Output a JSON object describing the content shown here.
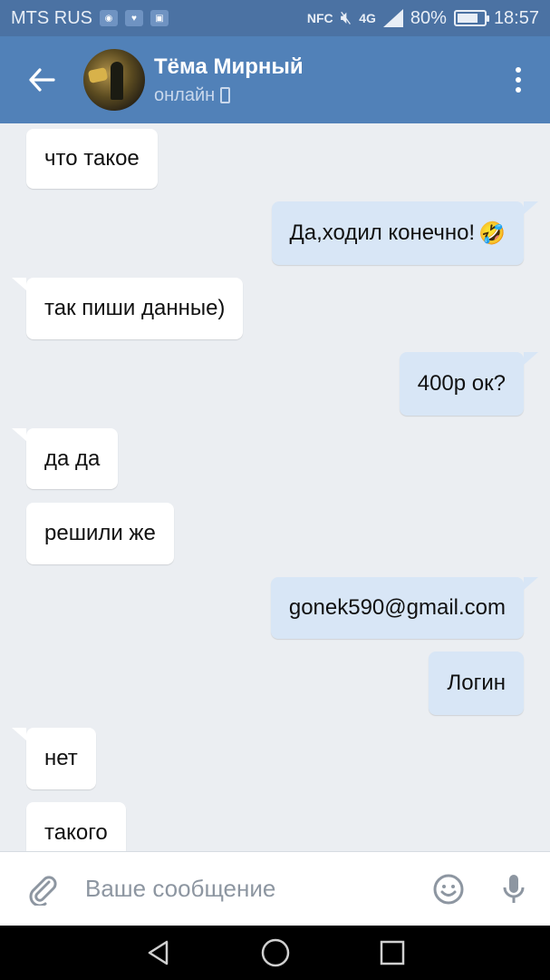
{
  "status_bar": {
    "carrier": "MTS RUS",
    "nfc": "NFC",
    "network": "4G",
    "battery": "80%",
    "battery_level": 0.8,
    "time": "18:57"
  },
  "header": {
    "contact_name": "Тёма Мирный",
    "contact_status": "онлайн"
  },
  "messages": [
    {
      "direction": "in",
      "text": "что такое"
    },
    {
      "direction": "out",
      "text": "Да,ходил конечно!",
      "emoji": "🤣"
    },
    {
      "direction": "in",
      "text": "так пиши данные)"
    },
    {
      "direction": "out",
      "text": "400р ок?"
    },
    {
      "direction": "in",
      "text": "да да"
    },
    {
      "direction": "in",
      "text": "решили же"
    },
    {
      "direction": "out",
      "text": "gonek590@gmail.com"
    },
    {
      "direction": "out",
      "text": "Логин"
    },
    {
      "direction": "in",
      "text": "нет"
    },
    {
      "direction": "in",
      "text": "такого"
    }
  ],
  "composer": {
    "placeholder": "Ваше сообщение",
    "value": ""
  },
  "colors": {
    "header": "#5181b8",
    "status_bar": "#4b72a3",
    "chat_background": "#ebeef2",
    "incoming_bubble": "#ffffff",
    "outgoing_bubble": "#d8e6f6"
  },
  "icons": {
    "back": "arrow-left-icon",
    "menu": "more-vertical-icon",
    "attach": "paperclip-icon",
    "emoji": "smiley-icon",
    "mic": "microphone-icon",
    "nav_back": "triangle-back-icon",
    "nav_home": "circle-home-icon",
    "nav_recents": "square-recents-icon"
  }
}
